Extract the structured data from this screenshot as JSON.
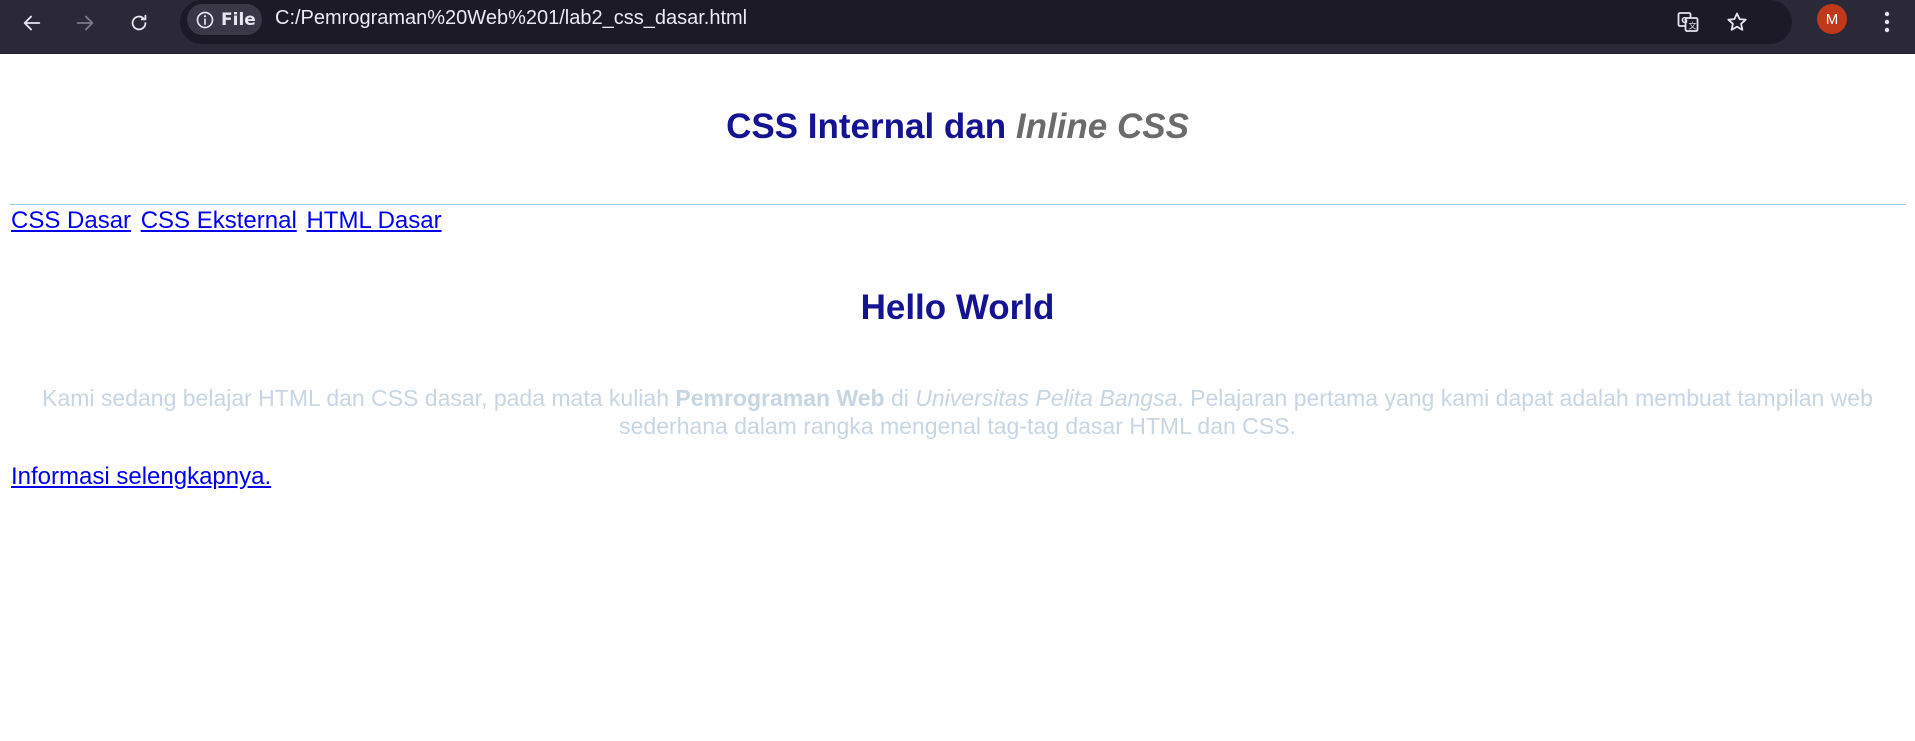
{
  "browser": {
    "site_chip_label": "File",
    "url": "C:/Pemrograman%20Web%201/lab2_css_dasar.html",
    "profile_initial": "M",
    "colors": {
      "toolbar": "#2b2838",
      "avatar": "#c0391b"
    }
  },
  "page": {
    "title_main": "CSS Internal dan ",
    "title_emphasis": "Inline CSS",
    "nav_links": [
      "CSS Dasar",
      "CSS Eksternal",
      "HTML Dasar"
    ],
    "heading": "Hello World",
    "paragraph": {
      "part1": "Kami sedang belajar HTML dan CSS dasar, pada mata kuliah ",
      "bold": "Pemrograman Web",
      "part2": " di ",
      "italic": "Universitas Pelita Bangsa",
      "part3": ". Pelajaran pertama yang kami dapat adalah membuat tampilan web sederhana dalam rangka mengenal tag-tag dasar HTML dan CSS."
    },
    "more_link": "Informasi selengkapnya.",
    "colors": {
      "heading": "#141493",
      "emphasis": "#6b6b6b",
      "link": "#0000ee",
      "paragraph": "#c8d6e3",
      "divider": "#9dc9e2"
    }
  }
}
